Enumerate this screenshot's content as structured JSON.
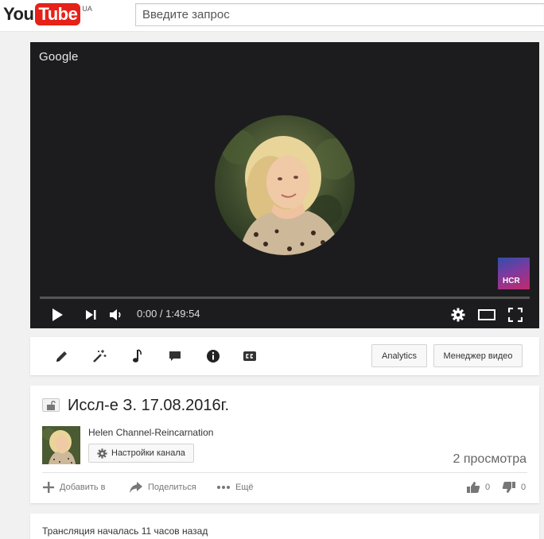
{
  "header": {
    "logo_you": "You",
    "logo_tube": "Tube",
    "logo_region": "UA",
    "search_placeholder": "Введите запрос"
  },
  "player": {
    "brand": "Google",
    "watermark_text": "HCR",
    "progress": 0,
    "time_current": "0:00",
    "time_separator": " / ",
    "time_total": "1:49:54"
  },
  "toolbar": {
    "analytics_label": "Analytics",
    "video_manager_label": "Менеджер видео"
  },
  "video": {
    "title": "Иссл-е З. 17.08.2016г.",
    "channel_name": "Helen Channel-Reincarnation",
    "channel_settings_label": "Настройки канала",
    "views": "2 просмотра",
    "add_to_label": "Добавить в",
    "share_label": "Поделиться",
    "more_label": "Ещё",
    "likes": "0",
    "dislikes": "0"
  },
  "description": {
    "stream_started": "Трансляция началась 11 часов назад"
  },
  "colors": {
    "brand_red": "#e62117",
    "player_bg": "#1c1c1e"
  }
}
